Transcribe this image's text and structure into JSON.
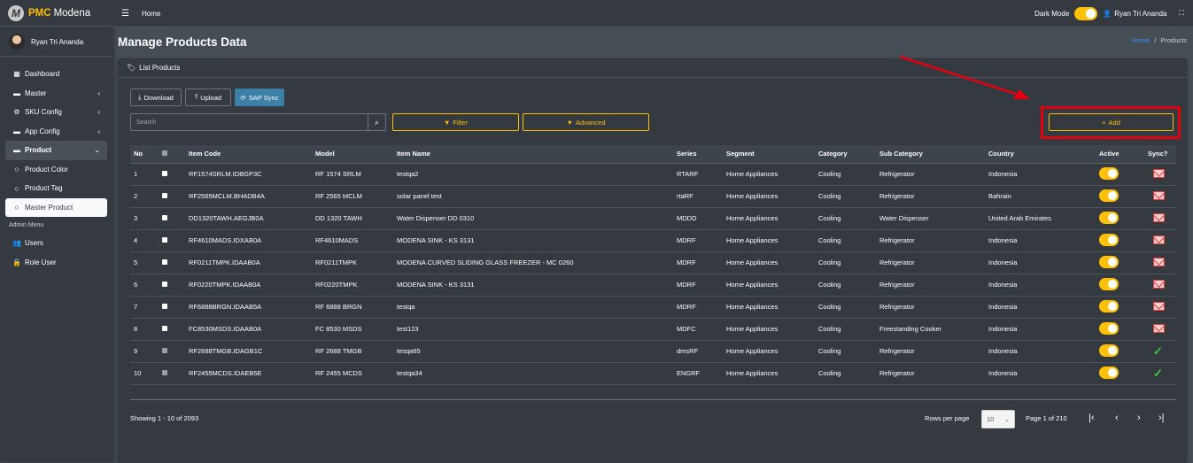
{
  "brand": {
    "logo_letter": "M",
    "pmc": "PMC",
    "name": "Modena"
  },
  "user": {
    "name": "Ryan Tri Ananda"
  },
  "sidebar": {
    "items": [
      {
        "label": "Dashboard",
        "icon": "grid-icon"
      },
      {
        "label": "Master",
        "icon": "truck-icon"
      },
      {
        "label": "SKU Config",
        "icon": "gear-icon"
      },
      {
        "label": "App Config",
        "icon": "truck-icon"
      },
      {
        "label": "Product",
        "icon": "box-icon"
      },
      {
        "label": "Product Color",
        "icon": "circle-icon"
      },
      {
        "label": "Product Tag",
        "icon": "circle-icon"
      },
      {
        "label": "Master Product",
        "icon": "circle-icon"
      }
    ],
    "admin_header": "Admin Menu",
    "admin_items": [
      {
        "label": "Users",
        "icon": "users-icon"
      },
      {
        "label": "Role User",
        "icon": "lock-icon"
      }
    ]
  },
  "topbar": {
    "home": "Home",
    "dark_mode": "Dark Mode",
    "user": "Ryan Tri Ananda"
  },
  "page": {
    "title": "Manage Products Data",
    "crumb_home": "Home",
    "crumb_sep": "/",
    "crumb_current": "Products"
  },
  "card": {
    "title": "List Products"
  },
  "toolbar": {
    "download": "Download",
    "upload": "Upload",
    "sap_sync": "SAP Sync",
    "search_placeholder": "Search",
    "filter": "Filter",
    "advanced": "Advanced",
    "add": "Add"
  },
  "table": {
    "headers": [
      "No",
      "",
      "Item Code",
      "Model",
      "Item Name",
      "Series",
      "Segment",
      "Category",
      "Sub Category",
      "Country",
      "Active",
      "Sync?"
    ],
    "rows": [
      {
        "no": "1",
        "code": "RF1574SRLM.IDBGP3C",
        "model": "RF 1574 SRLM",
        "name": "testqa2",
        "series": "RTARF",
        "segment": "Home Appliances",
        "category": "Cooling",
        "sub": "Refrigerator",
        "country": "Indonesia",
        "sync": "envelope"
      },
      {
        "no": "2",
        "code": "RF2565MCLM.BHADB4A",
        "model": "RF 2565 MCLM",
        "name": "solar panel test",
        "series": "rtaRF",
        "segment": "Home Appliances",
        "category": "Cooling",
        "sub": "Refrigerator",
        "country": "Bahrain",
        "sync": "envelope"
      },
      {
        "no": "3",
        "code": "DD1320TAWH.AEGJB0A",
        "model": "DD 1320 TAWH",
        "name": "Water Dispenser DD 0310",
        "series": "MDDD",
        "segment": "Home Appliances",
        "category": "Cooling",
        "sub": "Water Dispenser",
        "country": "United Arab Emirates",
        "sync": "envelope"
      },
      {
        "no": "4",
        "code": "RF4610MADS.IDXAB0A",
        "model": "RF4610MADS",
        "name": "MODENA SINK - KS 3131",
        "series": "MDRF",
        "segment": "Home Appliances",
        "category": "Cooling",
        "sub": "Refrigerator",
        "country": "Indonesia",
        "sync": "envelope"
      },
      {
        "no": "5",
        "code": "RF0211TMPK.IDAAB0A",
        "model": "RF0211TMPK",
        "name": "MODENA CURVED SLIDING GLASS FREEZER - MC 0260",
        "series": "MDRF",
        "segment": "Home Appliances",
        "category": "Cooling",
        "sub": "Refrigerator",
        "country": "Indonesia",
        "sync": "envelope"
      },
      {
        "no": "6",
        "code": "RF0220TMPK.IDAAB0A",
        "model": "RF0220TMPK",
        "name": "MODENA SINK - KS 3131",
        "series": "MDRF",
        "segment": "Home Appliances",
        "category": "Cooling",
        "sub": "Refrigerator",
        "country": "Indonesia",
        "sync": "envelope"
      },
      {
        "no": "7",
        "code": "RF6888BRGN.IDAAB5A",
        "model": "RF 6888 BRGN",
        "name": "testqa",
        "series": "MDRF",
        "segment": "Home Appliances",
        "category": "Cooling",
        "sub": "Refrigerator",
        "country": "Indonesia",
        "sync": "envelope"
      },
      {
        "no": "8",
        "code": "FC8530MSDS.IDAAB0A",
        "model": "FC 8530 MSDS",
        "name": "test123",
        "series": "MDFC",
        "segment": "Home Appliances",
        "category": "Cooling",
        "sub": "Freestanding Cooker",
        "country": "Indonesia",
        "sync": "envelope"
      },
      {
        "no": "9",
        "code": "RF2688TMGB.IDAGB1C",
        "model": "RF 2688 TMGB",
        "name": "tesqa65",
        "series": "dmsRF",
        "segment": "Home Appliances",
        "category": "Cooling",
        "sub": "Refrigerator",
        "country": "Indonesia",
        "sync": "check"
      },
      {
        "no": "10",
        "code": "RF2455MCDS.IDAEB5E",
        "model": "RF 2455 MCDS",
        "name": "testqa34",
        "series": "ENGRF",
        "segment": "Home Appliances",
        "category": "Cooling",
        "sub": "Refrigerator",
        "country": "Indonesia",
        "sync": "check"
      }
    ]
  },
  "footer": {
    "showing": "Showing 1 - 10 of 2093",
    "rows_per_page": "Rows per page",
    "rpp_value": "10",
    "page_info": "Page 1 of 210"
  },
  "colors": {
    "accent": "#ffc107",
    "highlight": "#e3000f",
    "link": "#3f8ef6"
  }
}
